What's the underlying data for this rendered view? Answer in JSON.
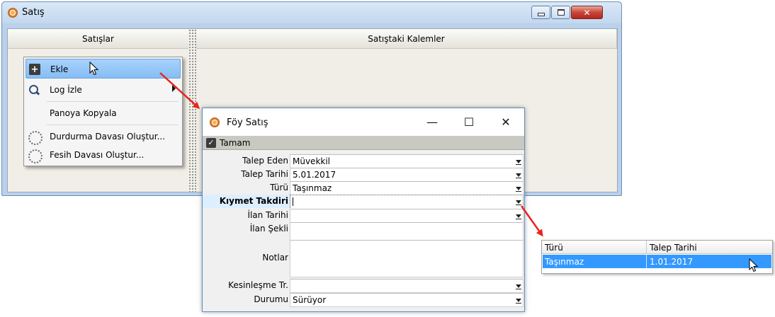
{
  "main_window": {
    "title": "Satış",
    "columns": {
      "left": "Satışlar",
      "right": "Satıştaki Kalemler"
    }
  },
  "context_menu": {
    "items": [
      {
        "label": "Ekle",
        "icon": "plus-icon",
        "highlighted": true
      },
      {
        "label": "Log İzle",
        "icon": "search-icon",
        "submenu": true
      },
      {
        "label": "Panoya Kopyala",
        "icon": ""
      },
      {
        "label": "Durdurma Davası Oluştur...",
        "icon": "dotted-circle-icon"
      },
      {
        "label": "Fesih Davası Oluştur...",
        "icon": "dotted-circle-icon"
      }
    ]
  },
  "dialog": {
    "title": "Föy Satış",
    "toolbar": {
      "ok_label": "Tamam"
    },
    "fields": [
      {
        "label": "Talep Eden",
        "value": "Müvekkil",
        "dropdown": true
      },
      {
        "label": "Talep Tarihi",
        "value": "5.01.2017",
        "dropdown": true
      },
      {
        "label": "Türü",
        "value": "Taşınmaz",
        "dropdown": true
      },
      {
        "label": "Kıymet Takdiri",
        "value": "",
        "dropdown": true,
        "bold": true
      },
      {
        "label": "İlan Tarihi",
        "value": "",
        "dropdown": true
      },
      {
        "label": "İlan Şekli",
        "value": "",
        "dropdown": false
      },
      {
        "label": "Notlar",
        "value": "",
        "dropdown": false
      },
      {
        "label": "Kesinleşme Tr.",
        "value": "",
        "dropdown": true
      },
      {
        "label": "Durumu",
        "value": "Sürüyor",
        "dropdown": true
      }
    ]
  },
  "lookup_popup": {
    "columns": [
      "Türü",
      "Talep Tarihi"
    ],
    "rows": [
      [
        "Taşınmaz",
        "1.01.2017"
      ]
    ]
  },
  "colors": {
    "arrow": "#e8251f",
    "selection": "#3399ff",
    "menu_highlight": "#a8d2fb"
  }
}
